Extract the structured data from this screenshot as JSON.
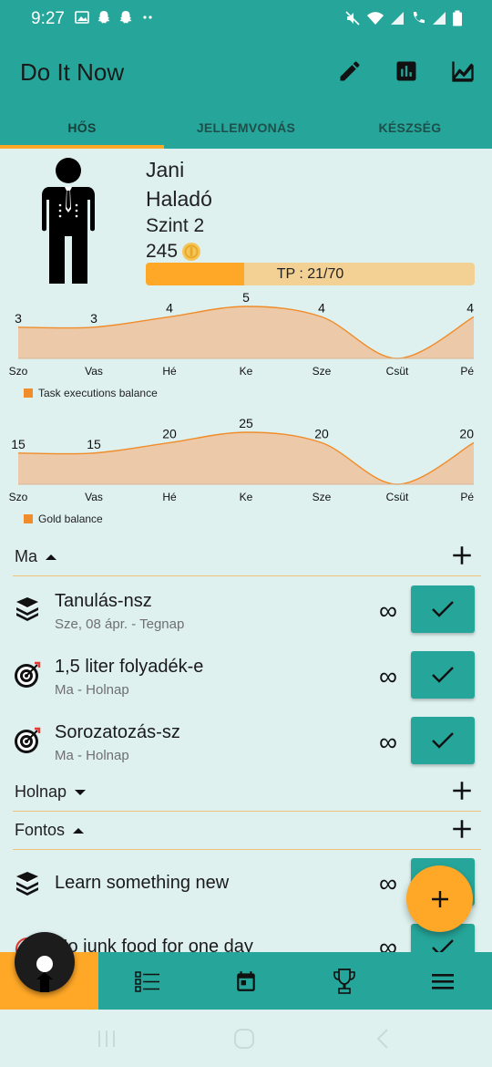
{
  "status_bar": {
    "time": "9:27"
  },
  "app_bar": {
    "title": "Do It Now"
  },
  "tabs": [
    {
      "label": "HŐS",
      "active": true
    },
    {
      "label": "JELLEMVONÁS",
      "active": false
    },
    {
      "label": "KÉSZSÉG",
      "active": false
    }
  ],
  "hero": {
    "name": "Jani",
    "rank": "Haladó",
    "level": "Szint 2",
    "gold": "245",
    "xp_label": "TP : 21/70",
    "xp_current": 21,
    "xp_max": 70
  },
  "chart_data": [
    {
      "type": "area",
      "categories": [
        "Szo",
        "Vas",
        "Hé",
        "Ke",
        "Sze",
        "Csüt",
        "Pé"
      ],
      "series": [
        {
          "name": "Task executions balance",
          "values": [
            3,
            3,
            4,
            5,
            4,
            0,
            4
          ]
        }
      ],
      "data_labels": [
        "3",
        "3",
        "4",
        "5",
        "4",
        "",
        "4"
      ],
      "legend": "bottom-left",
      "colors": {
        "fill": "#ecc9a8",
        "stroke": "#f08c2a"
      }
    },
    {
      "type": "area",
      "categories": [
        "Szo",
        "Vas",
        "Hé",
        "Ke",
        "Sze",
        "Csüt",
        "Pé"
      ],
      "series": [
        {
          "name": "Gold balance",
          "values": [
            15,
            15,
            20,
            25,
            20,
            0,
            20
          ]
        }
      ],
      "data_labels": [
        "15",
        "15",
        "20",
        "25",
        "20",
        "",
        "20"
      ],
      "legend": "bottom-left",
      "colors": {
        "fill": "#ecc9a8",
        "stroke": "#f08c2a"
      }
    }
  ],
  "sections": {
    "today": {
      "label": "Ma",
      "expanded": true
    },
    "tomorrow": {
      "label": "Holnap",
      "expanded": false
    },
    "important": {
      "label": "Fontos",
      "expanded": true
    }
  },
  "tasks_today": [
    {
      "icon": "books-icon",
      "title": "Tanulás-nsz",
      "subtitle": "Sze, 08 ápr. - Tegnap",
      "repeat": "∞"
    },
    {
      "icon": "target-icon",
      "title": "1,5 liter folyadék-e",
      "subtitle": "Ma - Holnap",
      "repeat": "∞"
    },
    {
      "icon": "target-icon",
      "title": "Sorozatozás-sz",
      "subtitle": "Ma - Holnap",
      "repeat": "∞"
    }
  ],
  "tasks_important": [
    {
      "icon": "books-icon",
      "title": "Learn something new",
      "subtitle": "",
      "repeat": "∞"
    },
    {
      "icon": "food-icon",
      "title": "No junk food for one day",
      "subtitle": "",
      "repeat": "∞"
    }
  ],
  "colors": {
    "primary": "#26a69a",
    "accent": "#ffa726",
    "background": "#def1ef"
  }
}
